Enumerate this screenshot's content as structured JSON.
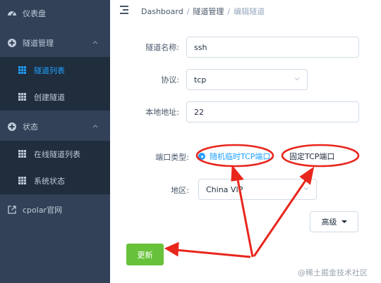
{
  "sidebar": {
    "dashboard": "仪表盘",
    "tunnel_mgmt": "隧道管理",
    "tunnel_list": "隧道列表",
    "create_tunnel": "创建隧道",
    "status": "状态",
    "online_list": "在线隧道列表",
    "system_status": "系统状态",
    "website": "cpolar官网"
  },
  "breadcrumb": {
    "home": "Dashboard",
    "section": "隧道管理",
    "current": "编辑隧道"
  },
  "form": {
    "name_label": "隧道名称:",
    "name_value": "ssh",
    "protocol_label": "协议:",
    "protocol_value": "tcp",
    "local_addr_label": "本地地址:",
    "local_addr_value": "22",
    "port_type_label": "端口类型:",
    "port_random": "随机临时TCP端口",
    "port_fixed": "固定TCP端口",
    "region_label": "地区:",
    "region_value": "China VIP",
    "advanced_label": "高级",
    "update_label": "更新"
  },
  "watermark": "@稀土掘金技术社区",
  "colors": {
    "sidebar_bg": "#324157",
    "submenu_bg": "#1f2d3d",
    "accent": "#20a0ff",
    "update_button": "#67c23a",
    "annotation_red": "#e8261c"
  },
  "icons": [
    "dashboard-icon",
    "plus-circle-icon",
    "grid-icon",
    "chevron-up-icon",
    "external-link-icon",
    "hamburger-icon",
    "caret-down-icon"
  ]
}
